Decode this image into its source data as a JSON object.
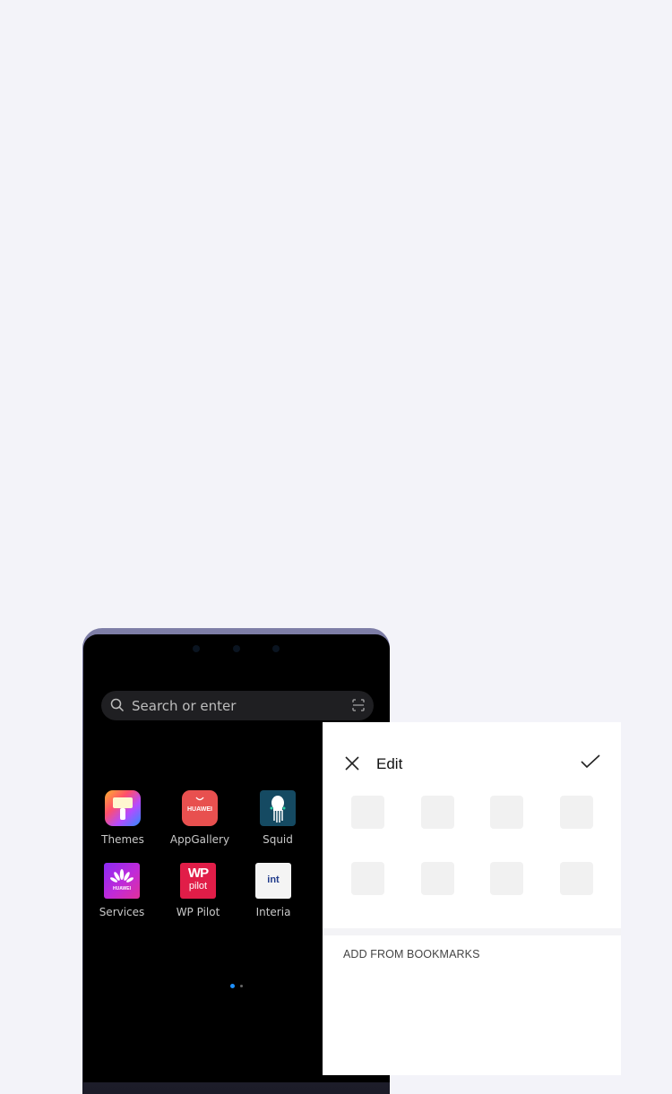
{
  "browser": {
    "search_placeholder": "Search or enter",
    "icons": {
      "search": "search-icon",
      "scan": "scan-icon"
    },
    "apps": [
      {
        "label": "Themes",
        "icon": "themes-icon"
      },
      {
        "label": "AppGallery",
        "icon": "appgallery-icon",
        "badge": "HUAWEI"
      },
      {
        "label": "Squid",
        "icon": "squid-icon"
      },
      {
        "label": "Services",
        "icon": "services-icon",
        "badge": "HUAWEI"
      },
      {
        "label": "WP Pilot",
        "icon": "wp-pilot-icon",
        "badge_top": "WP",
        "badge_bottom": "pilot"
      },
      {
        "label": "Interia",
        "icon": "interia-icon",
        "badge": "int"
      }
    ],
    "page_indicator": {
      "pages": 2,
      "current": 1,
      "active_color": "#1e90ff"
    }
  },
  "edit_panel": {
    "title": "Edit",
    "close_icon": "close-icon",
    "confirm_icon": "check-icon",
    "placeholder_tiles": 8,
    "section_label": "ADD FROM BOOKMARKS"
  }
}
